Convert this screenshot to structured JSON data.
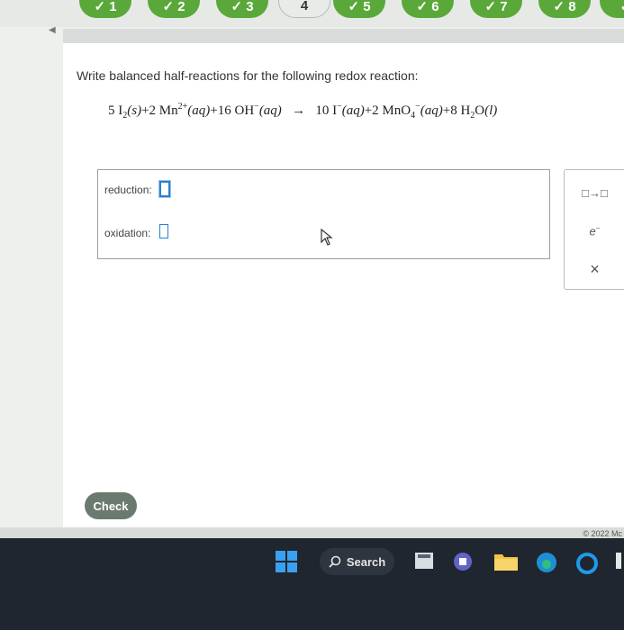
{
  "progress": {
    "steps": [
      {
        "label": "✓ 1",
        "state": "done"
      },
      {
        "label": "✓ 2",
        "state": "done"
      },
      {
        "label": "✓ 3",
        "state": "done"
      },
      {
        "label": "4",
        "state": "current"
      },
      {
        "label": "✓ 5",
        "state": "done"
      },
      {
        "label": "✓ 6",
        "state": "done"
      },
      {
        "label": "✓ 7",
        "state": "done"
      },
      {
        "label": "✓ 8",
        "state": "done"
      },
      {
        "label": "✓",
        "state": "done"
      }
    ]
  },
  "question": {
    "prompt": "Write balanced half-reactions for the following redox reaction:",
    "equation": {
      "coef1": "5",
      "i2": "I",
      "i2_sub": "2",
      "i2_state": "(s)",
      "plus1": "+2",
      "mn": "Mn",
      "mn_sup": "2+",
      "mn_state": "(aq)",
      "plus2": "+16",
      "oh": "OH",
      "oh_sup": "−",
      "oh_state": "(aq)",
      "arrow": "→",
      "coef_i": "10",
      "i_ion": "I",
      "i_sup": "−",
      "i_state": "(aq)",
      "plus3": "+2",
      "mno": "MnO",
      "mno_sub": "4",
      "mno_sup": "−",
      "mno_state": "(aq)",
      "plus4": "+8",
      "h2o": "H",
      "h2o_sub": "2",
      "h2o_o": "O",
      "h2o_state": "(l)"
    }
  },
  "answers": {
    "reduction_label": "reduction:",
    "oxidation_label": "oxidation:"
  },
  "tools": {
    "arrow_tool": "□→□",
    "electron_tool": "e",
    "electron_sup": "−",
    "clear_tool": "×"
  },
  "actions": {
    "check_label": "Check"
  },
  "footer": {
    "copyright": "© 2022 Mc"
  },
  "taskbar": {
    "search_label": "Search"
  },
  "colors": {
    "done_step": "#5aa83a",
    "input_border": "#2a7fd0",
    "check_button": "#6b7a6f",
    "taskbar": "#20262f"
  }
}
